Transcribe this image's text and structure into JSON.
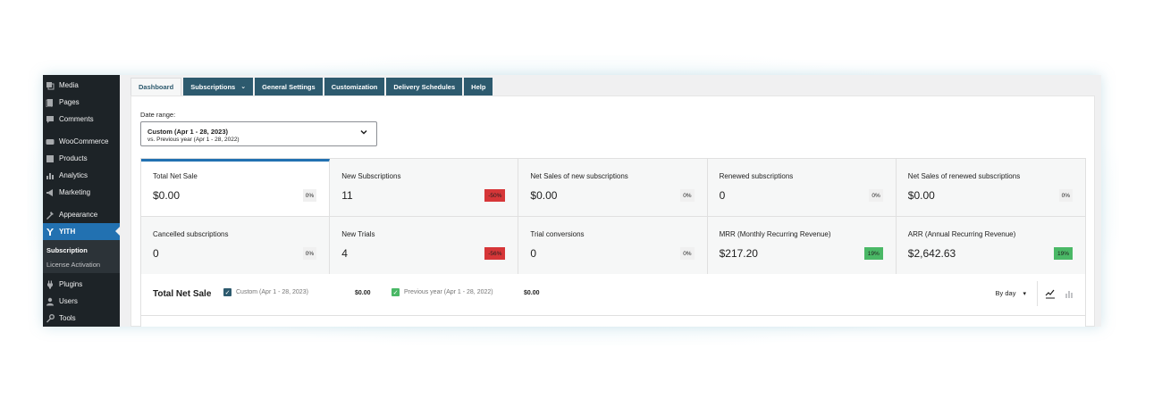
{
  "sidebar": {
    "items": [
      {
        "label": "Media",
        "icon": "media-icon"
      },
      {
        "label": "Pages",
        "icon": "pages-icon"
      },
      {
        "label": "Comments",
        "icon": "comments-icon"
      },
      {
        "label": "WooCommerce",
        "icon": "woocommerce-icon"
      },
      {
        "label": "Products",
        "icon": "products-icon"
      },
      {
        "label": "Analytics",
        "icon": "analytics-icon"
      },
      {
        "label": "Marketing",
        "icon": "marketing-icon"
      },
      {
        "label": "Appearance",
        "icon": "appearance-icon"
      },
      {
        "label": "YITH",
        "icon": "yith-icon"
      },
      {
        "label": "Plugins",
        "icon": "plugins-icon"
      },
      {
        "label": "Users",
        "icon": "users-icon"
      },
      {
        "label": "Tools",
        "icon": "tools-icon"
      }
    ],
    "submenu": [
      "Subscription",
      "License Activation"
    ]
  },
  "tabs": [
    "Dashboard",
    "Subscriptions",
    "General Settings",
    "Customization",
    "Delivery Schedules",
    "Help"
  ],
  "date_range": {
    "label": "Date range:",
    "main": "Custom (Apr 1 - 28, 2023)",
    "compare": "vs. Previous year (Apr 1 - 28, 2022)"
  },
  "cards": [
    {
      "label": "Total Net Sale",
      "value": "$0.00",
      "change": "0%"
    },
    {
      "label": "New Subscriptions",
      "value": "11",
      "change": "-50%"
    },
    {
      "label": "Net Sales of new subscriptions",
      "value": "$0.00",
      "change": "0%"
    },
    {
      "label": "Renewed subscriptions",
      "value": "0",
      "change": "0%"
    },
    {
      "label": "Net Sales of renewed subscriptions",
      "value": "$0.00",
      "change": "0%"
    },
    {
      "label": "Cancelled subscriptions",
      "value": "0",
      "change": "0%"
    },
    {
      "label": "New Trials",
      "value": "4",
      "change": "-56%"
    },
    {
      "label": "Trial conversions",
      "value": "0",
      "change": "0%"
    },
    {
      "label": "MRR (Monthly Recurring Revenue)",
      "value": "$217.20",
      "change": "19%"
    },
    {
      "label": "ARR (Annual Recurring Revenue)",
      "value": "$2,642.63",
      "change": "19%"
    }
  ],
  "chart": {
    "title": "Total Net Sale",
    "legend": [
      {
        "label": "Custom (Apr 1 - 28, 2023)",
        "value": "$0.00",
        "color": "#2d5a6e"
      },
      {
        "label": "Previous year (Apr 1 - 28, 2022)",
        "value": "$0.00",
        "color": "#4ab866"
      }
    ],
    "interval": "By day"
  },
  "colors": {
    "sidebar_bg": "#1d2327",
    "sidebar_active": "#2271b1",
    "tab_bg": "#2d5a6e",
    "negative": "#d63638",
    "positive": "#4ab866"
  }
}
